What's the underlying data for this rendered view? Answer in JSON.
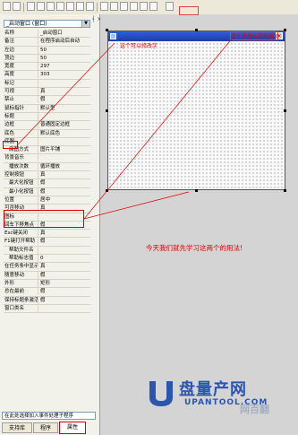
{
  "properties_panel": {
    "object_selector": "_启动窗口 (窗口)",
    "pin": "┤ ×",
    "rows": [
      {
        "k": "名称",
        "v": "_启动窗口"
      },
      {
        "k": "备注",
        "v": "在程序启动后自动"
      },
      {
        "k": "左边",
        "v": "50"
      },
      {
        "k": "顶边",
        "v": "50"
      },
      {
        "k": "宽度",
        "v": "297"
      },
      {
        "k": "高度",
        "v": "303"
      },
      {
        "k": "标记",
        "v": ""
      },
      {
        "k": "可视",
        "v": "真"
      },
      {
        "k": "禁止",
        "v": "假"
      },
      {
        "k": "鼠标指针",
        "v": "默认型"
      },
      {
        "k": "标题",
        "v": ""
      },
      {
        "k": "边框",
        "v": "普通固定边框"
      },
      {
        "k": "底色",
        "v": "默认底色"
      },
      {
        "k": "底图",
        "v": ""
      },
      {
        "k": "底图方式",
        "v": "图片平铺"
      },
      {
        "k": "背景音乐",
        "v": ""
      },
      {
        "k": "播放次数",
        "v": "循环播放"
      },
      {
        "k": "控制按钮",
        "v": "真"
      },
      {
        "k": "最大化按钮",
        "v": "假"
      },
      {
        "k": "最小化按钮",
        "v": "假"
      },
      {
        "k": "位置",
        "v": "居中"
      },
      {
        "k": "可否移动",
        "v": "真"
      },
      {
        "k": "图标",
        "v": ""
      },
      {
        "k": "回车下移焦点",
        "v": "假"
      },
      {
        "k": "Esc键关闭",
        "v": "真"
      },
      {
        "k": "F1键打开帮助",
        "v": "假"
      },
      {
        "k": "帮助文件名",
        "v": ""
      },
      {
        "k": "帮助标志值",
        "v": "0"
      },
      {
        "k": "在任务条中显示",
        "v": "真"
      },
      {
        "k": "随意移动",
        "v": "假"
      },
      {
        "k": "外形",
        "v": "矩形"
      },
      {
        "k": "总在最前",
        "v": "假"
      },
      {
        "k": "保持标题条激活",
        "v": "假"
      },
      {
        "k": "窗口类名",
        "v": ""
      }
    ],
    "event_selector": "在此处选择加入事件处理子程序",
    "tabs": {
      "support_lib": "支持库",
      "program": "程序",
      "properties": "属性"
    }
  },
  "designer": {
    "note_left": "这个可以修改字",
    "note_right": "这个是鼠标属性选项",
    "annotation": "今天我们就先学习这两个的用法!",
    "close_glyph": "✕",
    "form_border_color": "#555555",
    "titlebar_color": "#1b3fa8"
  },
  "watermark": {
    "brand_cn": "盘量产网",
    "brand_en": "UPANTOOL.COM",
    "brand_sub": "网百翻"
  },
  "colors": {
    "accent_red": "#e00000",
    "panel_bg": "#f3f2ea",
    "designer_bg": "#d4d4d4"
  }
}
